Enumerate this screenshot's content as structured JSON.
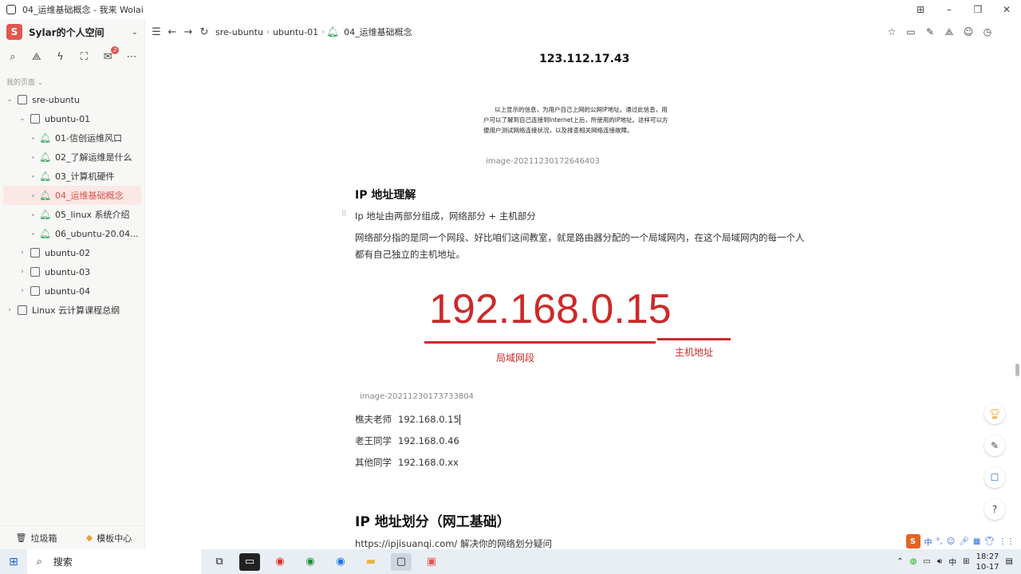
{
  "window": {
    "title": "04_运维基础概念 - 我来 Wolai",
    "controls": [
      "⊞",
      "–",
      "❐",
      "✕"
    ]
  },
  "sidebar": {
    "workspace_avatar": "S",
    "workspace_name": "Sylar的个人空间",
    "section_label": "我的页面 ⌄",
    "tools_badge": "2",
    "tree": [
      {
        "label": "sre-ubuntu",
        "level": 0,
        "kind": "doc",
        "caret": "⌄"
      },
      {
        "label": "ubuntu-01",
        "level": 1,
        "kind": "doc",
        "caret": "⌄"
      },
      {
        "label": "01-信创运维风口",
        "level": 2,
        "kind": "bell"
      },
      {
        "label": "02_了解运维是什么",
        "level": 2,
        "kind": "bell"
      },
      {
        "label": "03_计算机硬件",
        "level": 2,
        "kind": "bell"
      },
      {
        "label": "04_运维基础概念",
        "level": 2,
        "kind": "bell",
        "active": true
      },
      {
        "label": "05_linux 系统介绍",
        "level": 2,
        "kind": "bell"
      },
      {
        "label": "06_ubuntu-20.04...",
        "level": 2,
        "kind": "bell"
      },
      {
        "label": "ubuntu-02",
        "level": 1,
        "kind": "doc",
        "caret": "›"
      },
      {
        "label": "ubuntu-03",
        "level": 1,
        "kind": "doc",
        "caret": "›"
      },
      {
        "label": "ubuntu-04",
        "level": 1,
        "kind": "doc",
        "caret": "›"
      },
      {
        "label": "Linux 云计算课程总纲",
        "level": 0,
        "kind": "doc",
        "caret": "›"
      }
    ],
    "trash_label": "垃圾箱",
    "templates_label": "模板中心"
  },
  "nav": {
    "crumbs": [
      "sre-ubuntu",
      "ubuntu-01",
      "04_运维基础概念"
    ]
  },
  "content": {
    "image1_ip": "123.112.17.43",
    "image1_desc": "以上显示的信息，为用户自己上网的公网IP地址。通过此信息，用户可以了解到自己连接到Internet上后，所使用的IP地址。这样可以方便用户测试网络连接状况，以及排查相关网络连接故障。",
    "image1_caption": "image-20211230172646403",
    "heading1": "IP 地址理解",
    "para1": "Ip 地址由两部分组成，网络部分 + 主机部分",
    "para2": "网络部分指的是同一个网段、好比咱们这间教室，就是路由器分配的一个局域网内，在这个局域网内的每一个人都有自己独立的主机地址。",
    "big_ip": "192.168.0.15",
    "label_network": "局域网段",
    "label_host": "主机地址",
    "image2_caption": "image-20211230173733804",
    "ip_rows": [
      {
        "name": "樵夫老师",
        "ip": "192.168.0.15"
      },
      {
        "name": "老王同学",
        "ip": "192.168.0.46"
      },
      {
        "name": "其他同学",
        "ip": "192.168.0.xx"
      }
    ],
    "heading2": "IP 地址划分（网工基础）",
    "link_line": "https://ipjisuanqi.com/ 解决你的网络划分疑问"
  },
  "ime": {
    "lang": "中"
  },
  "taskbar": {
    "search_label": "搜索",
    "tray_lang": "中",
    "time": "18:27",
    "date": "10-17"
  },
  "colors": {
    "accent_red": "#cc2a2a",
    "active_bg": "#fbe7e5",
    "bell_green": "#3aa55d"
  }
}
